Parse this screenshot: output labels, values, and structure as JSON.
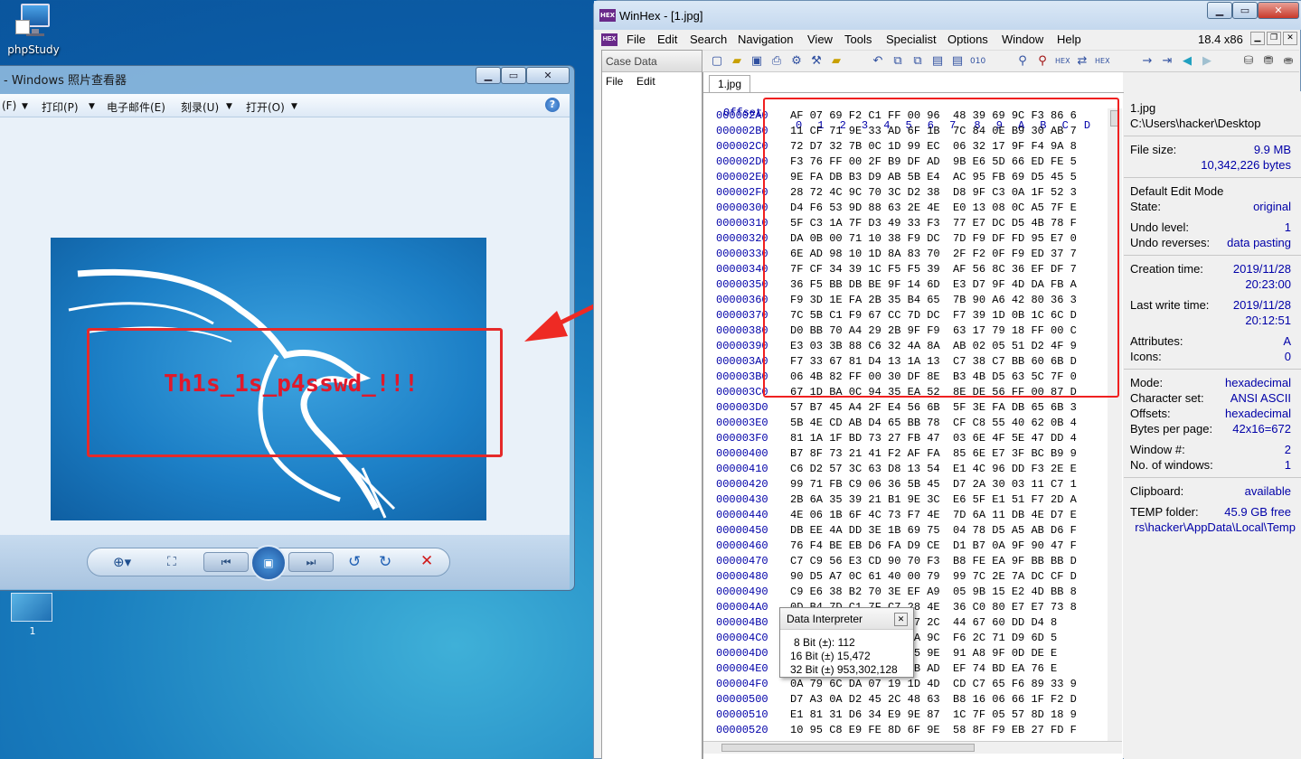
{
  "desktop": {
    "icon_label": "phpStudy",
    "thumb_label": "1"
  },
  "viewer": {
    "title": "- Windows 照片查看器",
    "menu": [
      "(F)",
      "打印(P)",
      "电子邮件(E)",
      "刻录(U)",
      "打开(O)"
    ],
    "help": "?",
    "caption": "Th1s_1s_p4sswd_!!!"
  },
  "winhex": {
    "title": "WinHex - [1.jpg]",
    "menu": [
      "File",
      "Edit",
      "Search",
      "Navigation",
      "View",
      "Tools",
      "Specialist",
      "Options",
      "Window",
      "Help"
    ],
    "version": "18.4 x86",
    "case_title": "Case Data",
    "case_menu": [
      "File",
      "Edit"
    ],
    "tab": "1.jpg",
    "offset_label": "Offset",
    "columns": [
      "0",
      "1",
      "2",
      "3",
      "4",
      "5",
      "6",
      "7",
      "8",
      "9",
      "A",
      "B",
      "C",
      "D"
    ],
    "rows": [
      {
        "o": "000002A0",
        "h": "AF 07 69 F2 C1 FF 00 96  48 39 69 9C F3 86 6"
      },
      {
        "o": "000002B0",
        "h": "11 CF 71 9E 33 AD 6F 1B  7C 84 0E B9 30 AB 7"
      },
      {
        "o": "000002C0",
        "h": "72 D7 32 7B 0C 1D 99 EC  06 32 17 9F F4 9A 8"
      },
      {
        "o": "000002D0",
        "h": "F3 76 FF 00 2F B9 DF AD  9B E6 5D 66 ED FE 5"
      },
      {
        "o": "000002E0",
        "h": "9E FA DB B3 D9 AB 5B E4  AC 95 FB 69 D5 45 5"
      },
      {
        "o": "000002F0",
        "h": "28 72 4C 9C 70 3C D2 38  D8 9F C3 0A 1F 52 3"
      },
      {
        "o": "00000300",
        "h": "D4 F6 53 9D 88 63 2E 4E  E0 13 08 0C A5 7F E"
      },
      {
        "o": "00000310",
        "h": "5F C3 1A 7F D3 49 33 F3  77 E7 DC D5 4B 78 F"
      },
      {
        "o": "00000320",
        "h": "DA 0B 00 71 10 38 F9 DC  7D F9 DF FD 95 E7 0"
      },
      {
        "o": "00000330",
        "h": "6E AD 98 10 1D 8A 83 70  2F F2 0F F9 ED 37 7"
      },
      {
        "o": "00000340",
        "h": "7F CF 34 39 1C F5 F5 39  AF 56 8C 36 EF DF 7"
      },
      {
        "o": "00000350",
        "h": "36 F5 BB DB BE 9F 14 6D  E3 D7 9F 4D DA FB A"
      },
      {
        "o": "00000360",
        "h": "F9 3D 1E FA 2B 35 B4 65  7B 90 A6 42 80 36 3"
      },
      {
        "o": "00000370",
        "h": "7C 5B C1 F9 67 CC 7D DC  F7 39 1D 0B 1C 6C D"
      },
      {
        "o": "00000380",
        "h": "D0 BB 70 A4 29 2B 9F F9  63 17 79 18 FF 00 C"
      },
      {
        "o": "00000390",
        "h": "E3 03 3B 88 C6 32 4A 8A  AB 02 05 51 D2 4F 9"
      },
      {
        "o": "000003A0",
        "h": "F7 33 67 81 D4 13 1A 13  C7 38 C7 BB 60 6B D"
      },
      {
        "o": "000003B0",
        "h": "06 4B 82 FF 00 30 DF 8E  B3 4B D5 63 5C 7F 0"
      },
      {
        "o": "000003C0",
        "h": "67 1D BA 0C 94 35 EA 52  8E DE 56 FF 00 87 D"
      },
      {
        "o": "000003D0",
        "h": "57 B7 45 A4 2F E4 56 6B  5F 3E FA DB 65 6B 3"
      },
      {
        "o": "000003E0",
        "h": "5B 4E CD AB D4 65 BB 78  CF C8 55 40 62 0B 4"
      },
      {
        "o": "000003F0",
        "h": "81 1A 1F BD 73 27 FB 47  03 6E 4F 5E 47 DD 4"
      },
      {
        "o": "00000400",
        "h": "B7 8F 73 21 41 F2 AF FA  85 6E E7 3F BC B9 9"
      },
      {
        "o": "00000410",
        "h": "C6 D2 57 3C 63 D8 13 54  E1 4C 96 DD F3 2E E"
      },
      {
        "o": "00000420",
        "h": "99 71 FB C9 06 36 5B 45  D7 2A 30 03 11 C7 1"
      },
      {
        "o": "00000430",
        "h": "2B 6A 35 39 21 B1 9E 3C  E6 5F E1 51 F7 2D A"
      },
      {
        "o": "00000440",
        "h": "4E 06 1B 6F 4C 73 F7 4E  7D 6A 11 DB 4E D7 E"
      },
      {
        "o": "00000450",
        "h": "DB EE 4A DD 3E 1B 69 75  04 78 D5 A5 AB D6 F"
      },
      {
        "o": "00000460",
        "h": "76 F4 BE EB D6 FA D9 CE  D1 B7 0A 9F 90 47 F"
      },
      {
        "o": "00000470",
        "h": "C7 C9 56 E3 CD 90 70 F3  B8 FE EA 9F BB BB D"
      },
      {
        "o": "00000480",
        "h": "90 D5 A7 0C 61 40 00 79  99 7C 2E 7A DC CF D"
      },
      {
        "o": "00000490",
        "h": "C9 E6 38 B2 70 3E EF A9  05 9B 15 E2 4D BB 8"
      },
      {
        "o": "000004A0",
        "h": "0D B4 7D C1 7F C7 28 4E  36 C0 80 E7 E7 73 8"
      },
      {
        "o": "000004B0",
        "h": "C8 F3 46 C1 8E 19 27 2C  44 67 60 DD D4 8"
      },
      {
        "o": "000004C0",
        "h": "BD 14 6E 6D A1 C6 3A 9C  F6 2C 71 D9 6D 5"
      },
      {
        "o": "000004D0",
        "h": "BD D6 9A 6C 42 F6 B5 9E  91 A8 9F 0D DE E"
      },
      {
        "o": "000004E0",
        "h": "BA 9E 56 E3 1F BE FB AD  EF 74 BD EA 76 E"
      },
      {
        "o": "000004F0",
        "h": "0A 79 6C DA 07 19 1D 4D  CD C7 65 F6 89 33 9"
      },
      {
        "o": "00000500",
        "h": "D7 A3 0A D2 45 2C 48 63  B8 16 06 66 1F F2 D"
      },
      {
        "o": "00000510",
        "h": "E1 81 31 D6 34 E9 9E 87  1C 7F 05 57 8D 18 9"
      },
      {
        "o": "00000520",
        "h": "10 95 C8 E9 FE 8D 6F 9E  58 8F F9 EB 27 FD F"
      }
    ],
    "info": {
      "filename": "1.jpg",
      "path": "C:\\Users\\hacker\\Desktop",
      "file_size_label": "File size:",
      "file_size_mb": "9.9 MB",
      "file_size_bytes": "10,342,226 bytes",
      "edit_mode": "Default Edit Mode",
      "state_label": "State:",
      "state": "original",
      "undo_level_label": "Undo level:",
      "undo_level": "1",
      "undo_rev_label": "Undo reverses:",
      "undo_rev": "data pasting",
      "creation_label": "Creation time:",
      "creation_date": "2019/11/28",
      "creation_time": "20:23:00",
      "lastwrite_label": "Last write time:",
      "lastwrite_date": "2019/11/28",
      "lastwrite_time": "20:12:51",
      "attr_label": "Attributes:",
      "attr": "A",
      "icons_label": "Icons:",
      "icons": "0",
      "mode_label": "Mode:",
      "mode": "hexadecimal",
      "charset_label": "Character set:",
      "charset": "ANSI ASCII",
      "offsets_label": "Offsets:",
      "offsets": "hexadecimal",
      "bpp_label": "Bytes per page:",
      "bpp": "42x16=672",
      "winnum_label": "Window #:",
      "winnum": "2",
      "nwin_label": "No. of windows:",
      "nwin": "1",
      "clip_label": "Clipboard:",
      "clip": "available",
      "temp_label": "TEMP folder:",
      "temp": "45.9 GB free",
      "temp_path": "rs\\hacker\\AppData\\Local\\Temp"
    },
    "interpreter": {
      "title": "Data Interpreter",
      "b8": "8 Bit (±): 112",
      "b16": "16 Bit (±) 15,472",
      "b32": "32 Bit (±) 953,302,128"
    }
  }
}
